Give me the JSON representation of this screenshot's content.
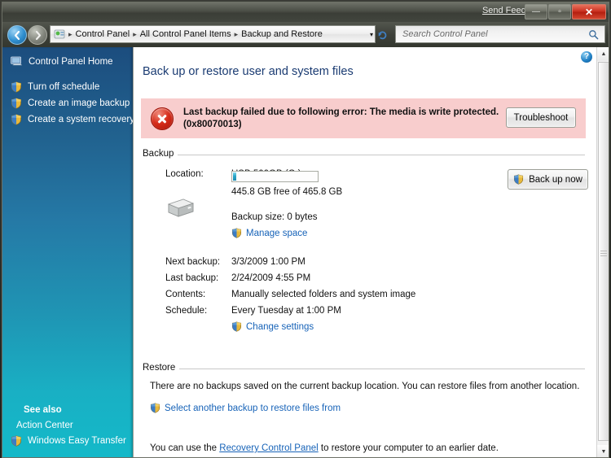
{
  "window": {
    "feedback_label": "Send Feedback",
    "minimize_label": "—",
    "maximize_label": "▫",
    "close_label": "✕"
  },
  "address_bar": {
    "back_label": "◀",
    "forward_label": "▶",
    "breadcrumbs": [
      "Control Panel",
      "All Control Panel Items",
      "Backup and Restore"
    ],
    "separator": "▸",
    "dropdown_label": "▾",
    "refresh_label": "↻",
    "search_placeholder": "Search Control Panel",
    "search_value": ""
  },
  "sidebar": {
    "home_label": "Control Panel Home",
    "items": [
      {
        "label": "Turn off schedule"
      },
      {
        "label": "Create an image backup"
      },
      {
        "label": "Create a system recovery disc"
      }
    ],
    "see_also_title": "See also",
    "see_also_items": [
      {
        "label": "Action Center",
        "has_shield": false
      },
      {
        "label": "Windows Easy Transfer",
        "has_shield": true
      }
    ]
  },
  "content": {
    "help_label": "?",
    "page_title": "Back up or restore user and system files",
    "error": {
      "line1": "Last backup failed due to following error: The media is write protected.",
      "line2": "(0x80070013)",
      "troubleshoot_label": "Troubleshoot"
    },
    "backup_section": {
      "title": "Backup",
      "location_label": "Location:",
      "location_value": "USB 500GB (G:)",
      "free_space": "445.8 GB free of 465.8 GB",
      "used_percent": 4,
      "backup_size": "Backup size: 0 bytes",
      "manage_space_label": "Manage space",
      "back_up_now_label": "Back up now",
      "details": [
        {
          "label": "Next backup:",
          "value": "3/3/2009 1:00 PM"
        },
        {
          "label": "Last backup:",
          "value": "2/24/2009 4:55 PM"
        },
        {
          "label": "Contents:",
          "value": "Manually selected folders and system image"
        },
        {
          "label": "Schedule:",
          "value": "Every Tuesday at 1:00 PM"
        }
      ],
      "change_settings_label": "Change settings"
    },
    "restore_section": {
      "title": "Restore",
      "description": "There are no backups saved on the current backup location. You can restore files from another location.",
      "select_backup_label": "Select another backup to restore files from",
      "recovery_prefix": "You can use the ",
      "recovery_link": "Recovery Control Panel",
      "recovery_suffix": " to restore your computer to an earlier date."
    }
  },
  "scrollbar": {
    "up_label": "▲",
    "down_label": "▼"
  },
  "colors": {
    "error_bg": "#f8cdcd",
    "error_icon": "#d62c1a",
    "link": "#1763b8",
    "title": "#1a3b72",
    "sidebar_top": "#1c4d7e",
    "sidebar_bottom": "#13b9c9",
    "close_button": "#cc3322",
    "progress_fill": "#2aa6c8"
  }
}
